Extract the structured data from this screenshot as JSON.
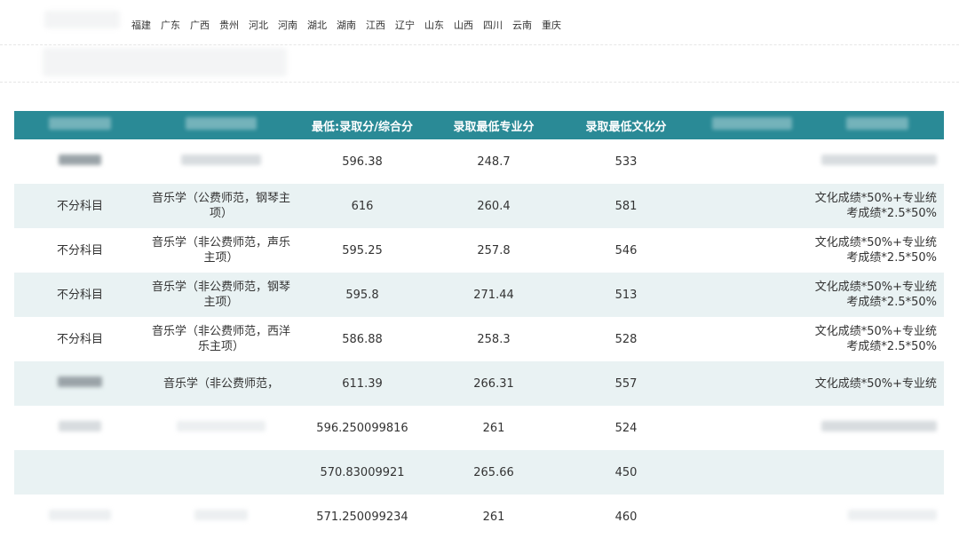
{
  "provinces": [
    "福建",
    "广东",
    "广西",
    "贵州",
    "河北",
    "河南",
    "湖北",
    "湖南",
    "江西",
    "辽宁",
    "山东",
    "山西",
    "四川",
    "云南",
    "重庆"
  ],
  "table": {
    "headers": {
      "min_score": "最低:录取分/综合分",
      "min_major": "录取最低专业分",
      "min_culture": "录取最低文化分"
    },
    "rows": [
      {
        "subject": "",
        "major": "",
        "min_score": "596.38",
        "min_major": "248.7",
        "min_culture": "533",
        "rule": ""
      },
      {
        "subject": "不分科目",
        "major": "音乐学（公费师范，钢琴主项）",
        "min_score": "616",
        "min_major": "260.4",
        "min_culture": "581",
        "rule": "文化成绩*50%+专业统考成绩*2.5*50%"
      },
      {
        "subject": "不分科目",
        "major": "音乐学（非公费师范，声乐主项）",
        "min_score": "595.25",
        "min_major": "257.8",
        "min_culture": "546",
        "rule": "文化成绩*50%+专业统考成绩*2.5*50%"
      },
      {
        "subject": "不分科目",
        "major": "音乐学（非公费师范，钢琴主项）",
        "min_score": "595.8",
        "min_major": "271.44",
        "min_culture": "513",
        "rule": "文化成绩*50%+专业统考成绩*2.5*50%"
      },
      {
        "subject": "不分科目",
        "major": "音乐学（非公费师范，西洋乐主项）",
        "min_score": "586.88",
        "min_major": "258.3",
        "min_culture": "528",
        "rule": "文化成绩*50%+专业统考成绩*2.5*50%"
      },
      {
        "subject": "",
        "major": "音乐学（非公费师范，",
        "min_score": "611.39",
        "min_major": "266.31",
        "min_culture": "557",
        "rule": "文化成绩*50%+专业统"
      },
      {
        "subject": "",
        "major": "",
        "min_score": "596.250099816",
        "min_major": "261",
        "min_culture": "524",
        "rule": ""
      },
      {
        "subject": "",
        "major": "",
        "min_score": "570.83009921",
        "min_major": "265.66",
        "min_culture": "450",
        "rule": ""
      },
      {
        "subject": "",
        "major": "",
        "min_score": "571.250099234",
        "min_major": "261",
        "min_culture": "460",
        "rule": ""
      }
    ]
  },
  "colors": {
    "header_bg": "#2a8a96",
    "alt_row_bg": "#e9f2f3"
  }
}
